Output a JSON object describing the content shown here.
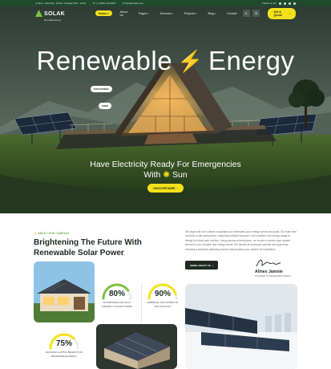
{
  "topbar": {
    "hours": "Mon - Sat 8:00 - 18:00 / Sunday 8:00 - 14:00",
    "phone": "+1 (555) 123-4567",
    "email": "hello@solak.com",
    "follow_label": "Follow Us On"
  },
  "nav": {
    "brand": "SOLAK",
    "brand_tag": "Renewable Energy",
    "items": [
      {
        "label": "Home",
        "has_menu": true
      },
      {
        "label": "About Us",
        "has_menu": false
      },
      {
        "label": "Pages",
        "has_menu": true
      },
      {
        "label": "Services",
        "has_menu": true
      },
      {
        "label": "Projects",
        "has_menu": true
      },
      {
        "label": "Blog",
        "has_menu": true
      },
      {
        "label": "Contact",
        "has_menu": false
      }
    ],
    "quote_label": "Get A Quote"
  },
  "hero": {
    "title_left": "Renewable",
    "title_right": "Energy",
    "chip_1": "SUN POWER",
    "chip_2": "FREE",
    "tagline_line1": "Have Electricity Ready For Emergencies",
    "tagline_with": "With",
    "tagline_sun": "Sun",
    "button_label": "DISCOVER MORE"
  },
  "about": {
    "eyebrow": "ABOUT OUR COMPANY",
    "heading": "Brightening The Future With Renewable Solar Power",
    "body": "We begin with an in-depth consultation to understand your energy needs and goals. Our team then conducts a site assessment, analyzing sunlight exposure, roof condition and energy usage to design the ideal solar solution. Using advanced techniques, we create a custom solar system tailored to your location and energy needs. We handle all necessary permits and approvals, ensuring a seamless planning process that prepares your system for installation.",
    "button_label": "MORE ABOUT US",
    "signer_name": "Allnes Jamnie",
    "signer_role": "MANAGER OF RENEWABLE ENERGY"
  },
  "stats": [
    {
      "value": "80%",
      "label": "AFFORDABLE AND ECO-FRIENDLY SOLAR POWER",
      "fraction": 0.8
    },
    {
      "value": "90%",
      "label": "EMBRACE THE POWER OF THE SUNLIGHT",
      "fraction": 0.9
    },
    {
      "value": "75%",
      "label": "ADVANCE CAPITAL BENEFITS IN RENEWABLE ENERGY",
      "fraction": 0.75
    }
  ],
  "colors": {
    "brand_dark": "#1f4a2c",
    "accent_yellow": "#f3e21a",
    "accent_green": "#7cc242"
  }
}
